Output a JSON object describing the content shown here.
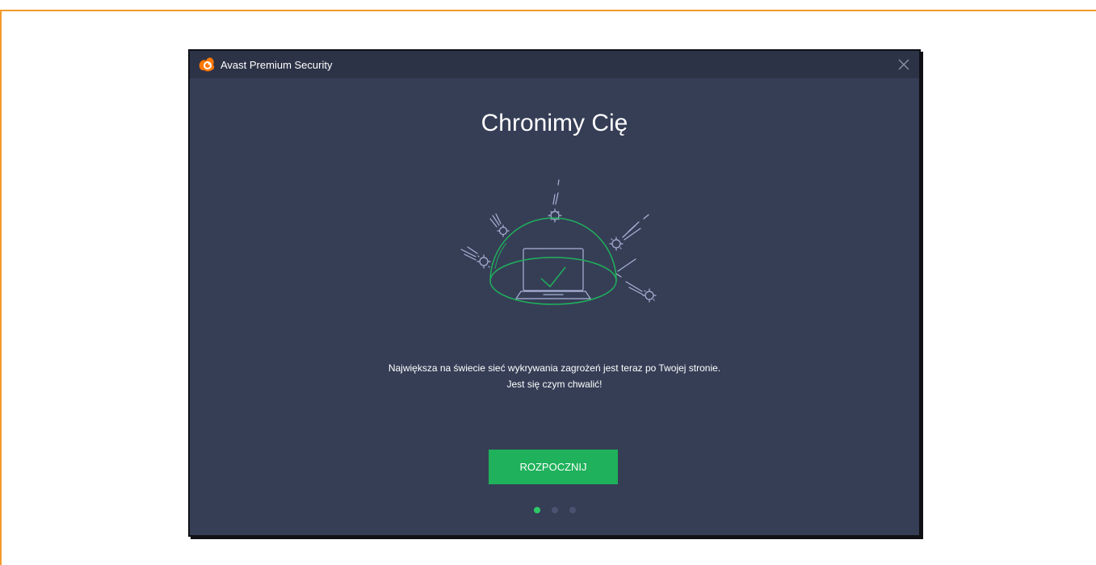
{
  "window": {
    "title": "Avast Premium Security"
  },
  "page": {
    "heading": "Chronimy Cię",
    "message_line1": "Największa na świecie sieć wykrywania zagrożeń jest teraz po Twojej stronie.",
    "message_line2": "Jest się czym chwalić!",
    "button_label": "ROZPOCZNIJ"
  },
  "pagination": {
    "total": 3,
    "active_index": 0
  },
  "icons": {
    "logo": "avast-logo-icon",
    "close": "close-icon",
    "illustration": "shield-dome-laptop-icon",
    "check": "check-icon",
    "virus": "virus-icon"
  },
  "colors": {
    "window_bg": "#363e56",
    "titlebar_bg": "#2d3347",
    "accent_green": "#1fb15b",
    "line_art": "#a9b3d6",
    "border_orange": "#f39a2c"
  }
}
